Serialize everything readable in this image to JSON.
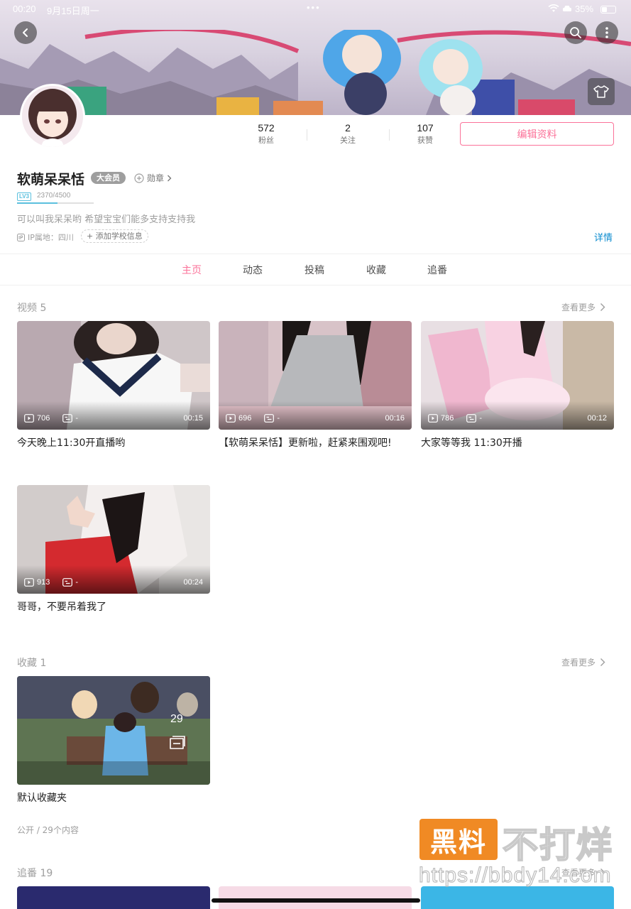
{
  "status_bar": {
    "time": "00:20",
    "date": "9月15日周一",
    "dots": "•••",
    "battery": "35%"
  },
  "banner": {
    "icons": [
      "back-icon",
      "search-icon",
      "more-vertical-icon",
      "shirt-icon"
    ]
  },
  "stats": [
    {
      "num": "572",
      "label": "粉丝"
    },
    {
      "num": "2",
      "label": "关注"
    },
    {
      "num": "107",
      "label": "获赞"
    }
  ],
  "edit_button": "编辑资料",
  "profile": {
    "name": "软萌呆呆恬",
    "vip_badge": "大会员",
    "medal": "勋章",
    "level": "LV3",
    "exp": "2370/4500",
    "exp_fraction": 0.527,
    "bio": "可以叫我呆呆哟 希望宝宝们能多支持支持我",
    "ip": "IP属地：四川",
    "school": "添加学校信息",
    "detail": "详情"
  },
  "tabs": [
    {
      "label": "主页",
      "active": true
    },
    {
      "label": "动态",
      "active": false
    },
    {
      "label": "投稿",
      "active": false
    },
    {
      "label": "收藏",
      "active": false
    },
    {
      "label": "追番",
      "active": false
    }
  ],
  "videos_section": {
    "title": "视频 5",
    "see_more": "查看更多",
    "items": [
      {
        "plays": "706",
        "danmaku": "-",
        "duration": "00:15",
        "title": "今天晚上11:30开直播哟"
      },
      {
        "plays": "696",
        "danmaku": "-",
        "duration": "00:16",
        "title": "【软萌呆呆恬】更新啦，赶紧来围观吧!"
      },
      {
        "plays": "786",
        "danmaku": "-",
        "duration": "00:12",
        "title": "大家等等我 11:30开播"
      },
      {
        "plays": "913",
        "danmaku": "-",
        "duration": "00:24",
        "title": "哥哥，不要吊着我了"
      }
    ]
  },
  "favorites_section": {
    "title": "收藏 1",
    "see_more": "查看更多",
    "folder": {
      "count": "29",
      "title": "默认收藏夹",
      "sub": "公开 / 29个内容"
    }
  },
  "bangumi_section": {
    "title": "追番 19",
    "see_more": "查看更多"
  },
  "watermark": {
    "badge": "黑料",
    "text": "不打烊",
    "url": "https://bbdy14.com"
  },
  "colors": {
    "accent": "#fb7299",
    "link": "#0a8bcf",
    "level": "#5bc0de"
  }
}
